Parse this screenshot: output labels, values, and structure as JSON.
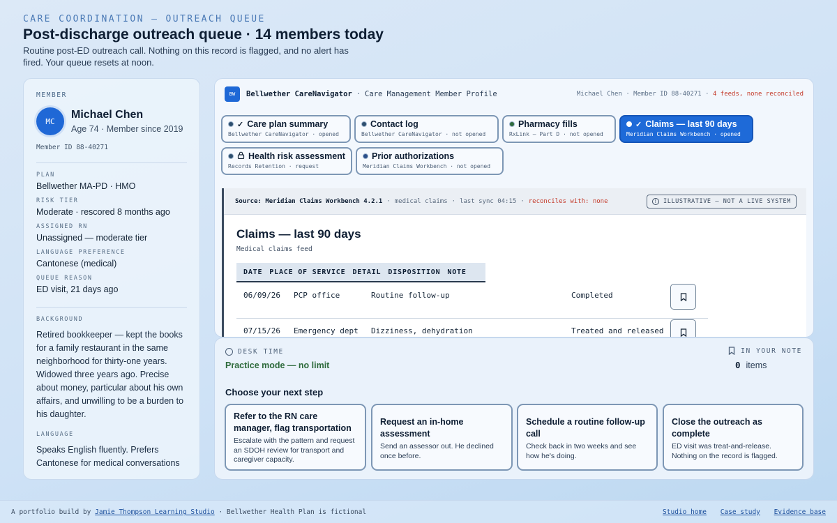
{
  "header": {
    "eyebrow": "CARE COORDINATION — OUTREACH QUEUE",
    "title": "Post-discharge outreach queue · 14 members today",
    "subtitle": "Routine post-ED outreach call. Nothing on this record is flagged, and no alert has fired. Your queue resets at noon."
  },
  "member": {
    "eyebrow": "MEMBER",
    "initials": "MC",
    "name": "Michael Chen",
    "age_line": "Age 74 · Member since 2019",
    "member_id": "Member ID 88-40271",
    "fields": [
      {
        "label": "PLAN",
        "value": "Bellwether MA-PD · HMO"
      },
      {
        "label": "RISK TIER",
        "value": "Moderate · rescored 8 months ago"
      },
      {
        "label": "ASSIGNED RN",
        "value": "Unassigned — moderate tier"
      },
      {
        "label": "LANGUAGE PREFERENCE",
        "value": "Cantonese (medical)"
      },
      {
        "label": "QUEUE REASON",
        "value": "ED visit, 21 days ago"
      }
    ],
    "background_label": "BACKGROUND",
    "background": "Retired bookkeeper — kept the books for a family restaurant in the same neighborhood for thirty-one years. Widowed three years ago. Precise about money, particular about his own affairs, and unwilling to be a burden to his daughter.",
    "language_label": "LANGUAGE",
    "language": "Speaks English fluently. Prefers Cantonese for medical conversations"
  },
  "app": {
    "logo": "BW",
    "name": "Bellwether CareNavigator",
    "module": "Care Management Member Profile",
    "right_info": "Michael Chen · Member ID 88-40271 ·",
    "right_alert": "4 feeds, none reconciled",
    "tabs": [
      {
        "label": "Care plan summary",
        "meta": "Bellwether CareNavigator · opened",
        "icon": "check"
      },
      {
        "label": "Contact log",
        "meta": "Bellwether CareNavigator · not opened",
        "icon": ""
      },
      {
        "label": "Pharmacy fills",
        "meta": "RxLink — Part D · not opened",
        "icon": ""
      },
      {
        "label": "Claims — last 90 days",
        "meta": "Meridian Claims Workbench · opened",
        "icon": "check"
      },
      {
        "label": "Health risk assessment",
        "meta": "Records Retention · request",
        "icon": "lock"
      },
      {
        "label": "Prior authorizations",
        "meta": "Meridian Claims Workbench · not opened",
        "icon": ""
      }
    ]
  },
  "doc": {
    "source": "Source: Meridian Claims Workbench 4.2.1",
    "feed": "medical claims",
    "sync": "last sync 04:15",
    "reconciles": "reconciles with: none",
    "illustrative": "ILLUSTRATIVE — NOT A LIVE SYSTEM",
    "title": "Claims — last 90 days",
    "subtitle": "Medical claims feed",
    "columns": [
      "DATE",
      "PLACE OF SERVICE",
      "DETAIL",
      "DISPOSITION",
      "NOTE"
    ],
    "rows": [
      {
        "date": "06/09/26",
        "place": "PCP office",
        "detail": "Routine follow-up",
        "disposition": "Completed"
      },
      {
        "date": "07/15/26",
        "place": "Emergency dept",
        "detail": "Dizziness, dehydration",
        "disposition": "Treated and released"
      }
    ]
  },
  "bottom": {
    "desk_label": "DESK TIME",
    "desk_value": "Practice mode — no limit",
    "note_label": "IN YOUR NOTE",
    "note_count": "0",
    "note_unit": "items",
    "choose": "Choose your next step",
    "options": [
      {
        "title": "Refer to the RN care manager, flag transportation",
        "desc": "Escalate with the pattern and request an SDOH review for transport and caregiver capacity."
      },
      {
        "title": "Request an in-home assessment",
        "desc": "Send an assessor out. He declined once before."
      },
      {
        "title": "Schedule a routine follow-up call",
        "desc": "Check back in two weeks and see how he's doing."
      },
      {
        "title": "Close the outreach as complete",
        "desc": "ED visit was treat-and-release. Nothing on the record is flagged."
      }
    ]
  },
  "footer": {
    "prefix": "A portfolio build by",
    "author": "Jamie Thompson Learning Studio",
    "suffix": "· Bellwether Health Plan is fictional",
    "links": [
      "Studio home",
      "Case study",
      "Evidence base"
    ]
  }
}
